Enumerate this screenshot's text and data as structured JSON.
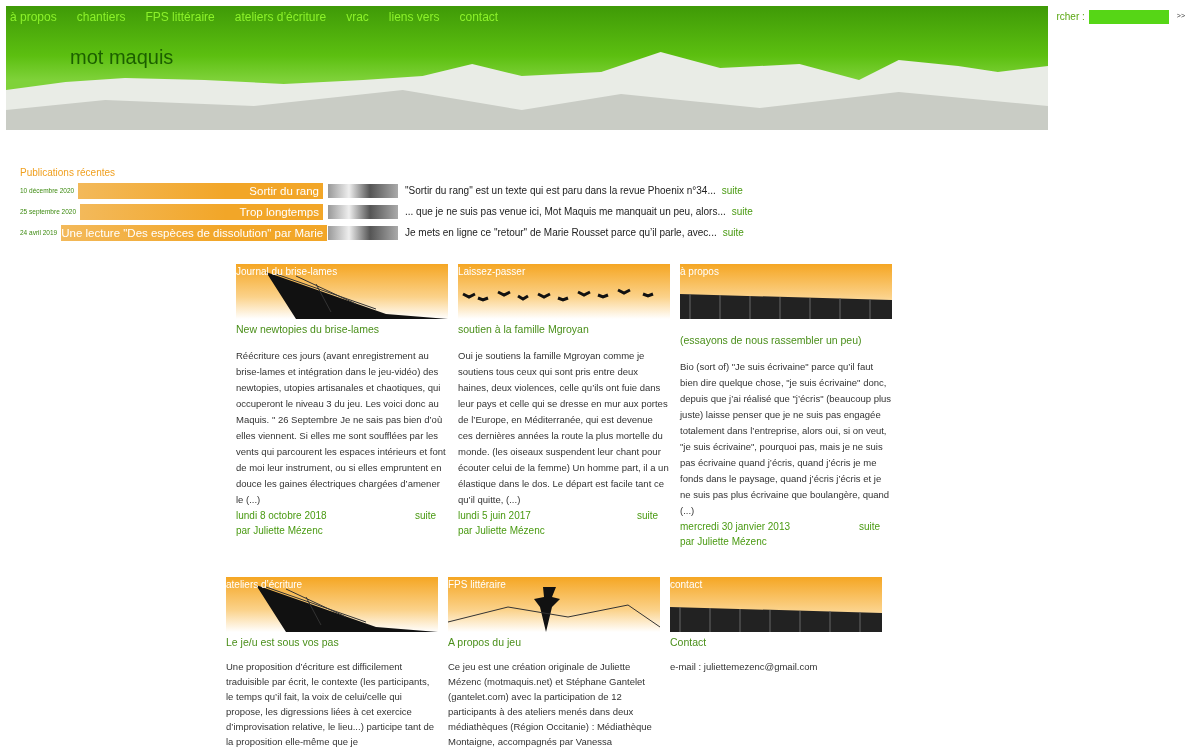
{
  "nav": [
    "à propos",
    "chantiers",
    "FPS littéraire",
    "ateliers d’écriture",
    "vrac",
    "liens vers",
    "contact"
  ],
  "site_title": "mot maquis",
  "search": {
    "label": "rcher :",
    "button": ">>"
  },
  "recent": {
    "heading": "Publications récentes",
    "items": [
      {
        "date": "10 décembre 2020",
        "title": "Sortir du rang",
        "excerpt": "\"Sortir du rang\" est un texte qui est paru dans la revue Phoenix n°34...",
        "more": "suite"
      },
      {
        "date": "25 septembre 2020",
        "title": "Trop longtemps",
        "excerpt": "... que je ne suis pas venue ici, Mot Maquis me manquait un peu, alors...",
        "more": "suite"
      },
      {
        "date": "24 avril 2019",
        "title": "Une lecture \"Des espèces de dissolution\" par Marie",
        "excerpt": "Je mets en ligne ce \"retour\" de Marie Rousset parce qu’il parle, avec...",
        "more": "suite"
      }
    ]
  },
  "card_rows": [
    [
      {
        "section": "Journal du brise-lames",
        "kind": "tower",
        "title": "New newtopies du brise-lames",
        "body": "Réécriture ces jours (avant enregistrement au brise-lames et intégration dans le jeu-vidéo) des newtopies, utopies artisanales et chaotiques, qui occuperont le niveau 3 du jeu. Les voici donc au Maquis. \" 26 Septembre Je ne sais pas bien d’où elles viennent. Si elles me sont soufflées par les vents qui parcourent les espaces intérieurs et font de moi leur instrument, ou si elles empruntent en douce les gaines électriques chargées d’amener le (...)",
        "date": "lundi 8 octobre 2018",
        "more": "suite",
        "author": "par Juliette Mézenc"
      },
      {
        "section": "Laissez-passer",
        "kind": "birds",
        "title": "soutien à la famille Mgroyan",
        "body": "Oui je soutiens la famille Mgroyan comme je soutiens tous ceux qui sont pris entre deux haines, deux violences, celle qu’ils ont fuie dans leur pays et celle qui se dresse en mur aux portes de l’Europe, en Méditerranée, qui est devenue ces dernières années la route la plus mortelle du monde. (les oiseaux suspendent leur chant pour écouter celui de la femme) Un homme part, il a un élastique dans le dos. Le départ est facile tant ce qu’il quitte, (...)",
        "date": "lundi 5 juin 2017",
        "more": "suite",
        "author": "par Juliette Mézenc"
      },
      {
        "section": "à propos",
        "kind": "pier",
        "title": "(essayons de nous rassembler un peu)",
        "body": "Bio (sort of) \"Je suis écrivaine\" parce qu’il faut bien dire quelque chose, \"je suis écrivaine\" donc, depuis que j’ai réalisé que \"j’écris\" (beaucoup plus juste) laisse penser que je ne suis pas engagée totalement dans l’entreprise, alors oui, si on veut, \"je suis écrivaine\", pourquoi pas, mais je ne suis pas écrivaine quand j’écris, quand j’écris je me fonds dans le paysage, quand j’écris j’écris et je ne suis pas plus écrivaine que boulangère, quand (...)",
        "date": "mercredi 30 janvier 2013",
        "more": "suite",
        "author": "par Juliette Mézenc"
      }
    ],
    [
      {
        "section": "ateliers d’écriture",
        "kind": "tower",
        "title": "Le je/u est sous vos pas",
        "body": "Une proposition d’écriture est difficilement traduisible par écrit, le contexte (les participants, le temps qu’il fait, la voix de celui/celle qui propose, les digressions liées à cet exercice d’improvisation relative, le lieu...) participe tant de la proposition elle-même que je"
      },
      {
        "section": "FPS littéraire",
        "kind": "pagoda",
        "title": "A propos du jeu",
        "body": "Ce jeu est une création originale de Juliette Mézenc (motmaquis.net) et Stéphane Gantelet (gantelet.com) avec la participation de 12 participants à des ateliers menés dans deux médiathèques (Région Occitanie) : Médiathèque Montaigne, accompagnés par Vanessa"
      },
      {
        "section": "contact",
        "kind": "pier",
        "title": "Contact",
        "body": "e-mail : juliettemezenc@gmail.com"
      }
    ]
  ]
}
